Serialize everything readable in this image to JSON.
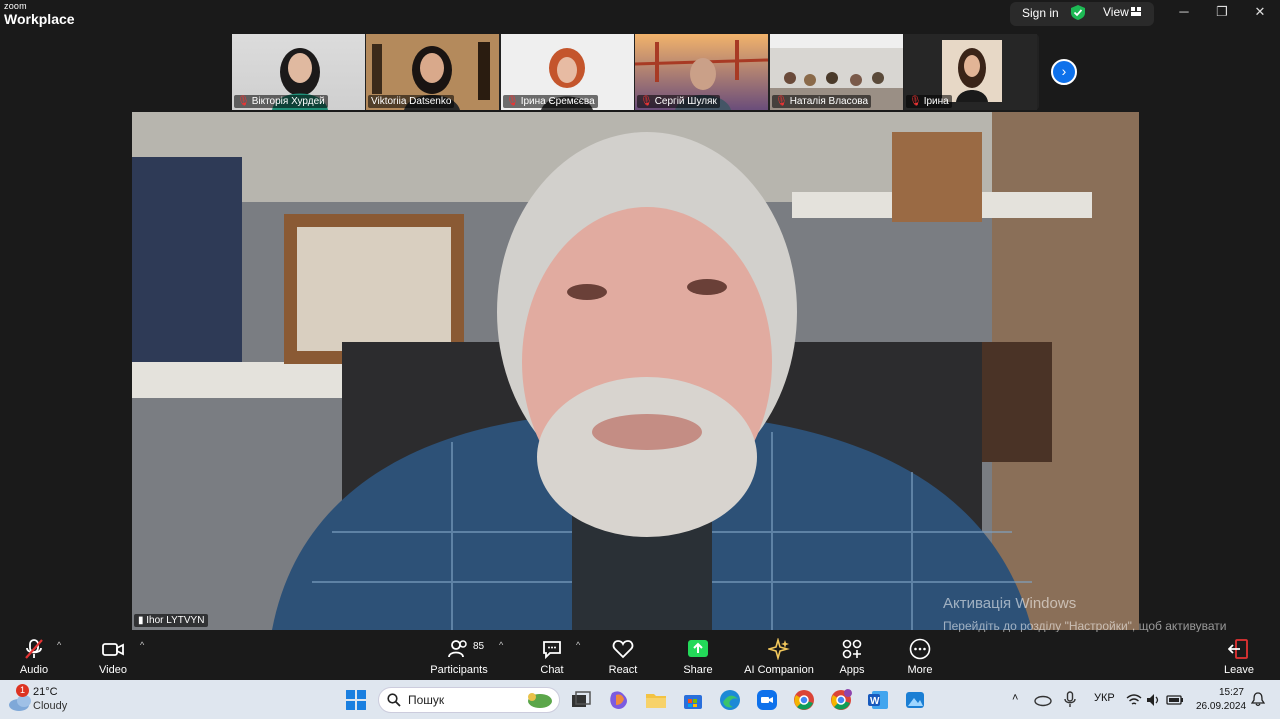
{
  "titlebar": {
    "logo_top": "zoom",
    "logo_bottom": "Workplace",
    "signin": "Sign in",
    "view": "View"
  },
  "thumbnails": [
    {
      "name": "Вікторія Хурдей",
      "muted": true
    },
    {
      "name": "Viktoriia Datsenko",
      "muted": false
    },
    {
      "name": "Ірина Єремєєва",
      "muted": true
    },
    {
      "name": "Сергій Шуляк",
      "muted": true
    },
    {
      "name": "Наталія Власова",
      "muted": true
    },
    {
      "name": "Ірина",
      "muted": true
    }
  ],
  "speaker": {
    "name": "Ihor LYTVYN"
  },
  "activation": {
    "title": "Активація Windows",
    "message": "Перейдіть до розділу \"Настройки\", щоб активувати Windows."
  },
  "toolbar": {
    "audio": "Audio",
    "video": "Video",
    "participants": "Participants",
    "participants_count": "85",
    "chat": "Chat",
    "react": "React",
    "share": "Share",
    "ai_companion": "AI Companion",
    "apps": "Apps",
    "more": "More",
    "leave": "Leave"
  },
  "taskbar": {
    "weather_badge": "1",
    "weather_temp": "21°C",
    "weather_desc": "Cloudy",
    "search_placeholder": "Пошук",
    "language": "УКР",
    "time": "15:27",
    "date": "26.09.2024"
  },
  "colors": {
    "zoom_blue": "#0e71eb",
    "share_green": "#23d959",
    "muted_red": "#e33333",
    "shield_green": "#1db954"
  }
}
